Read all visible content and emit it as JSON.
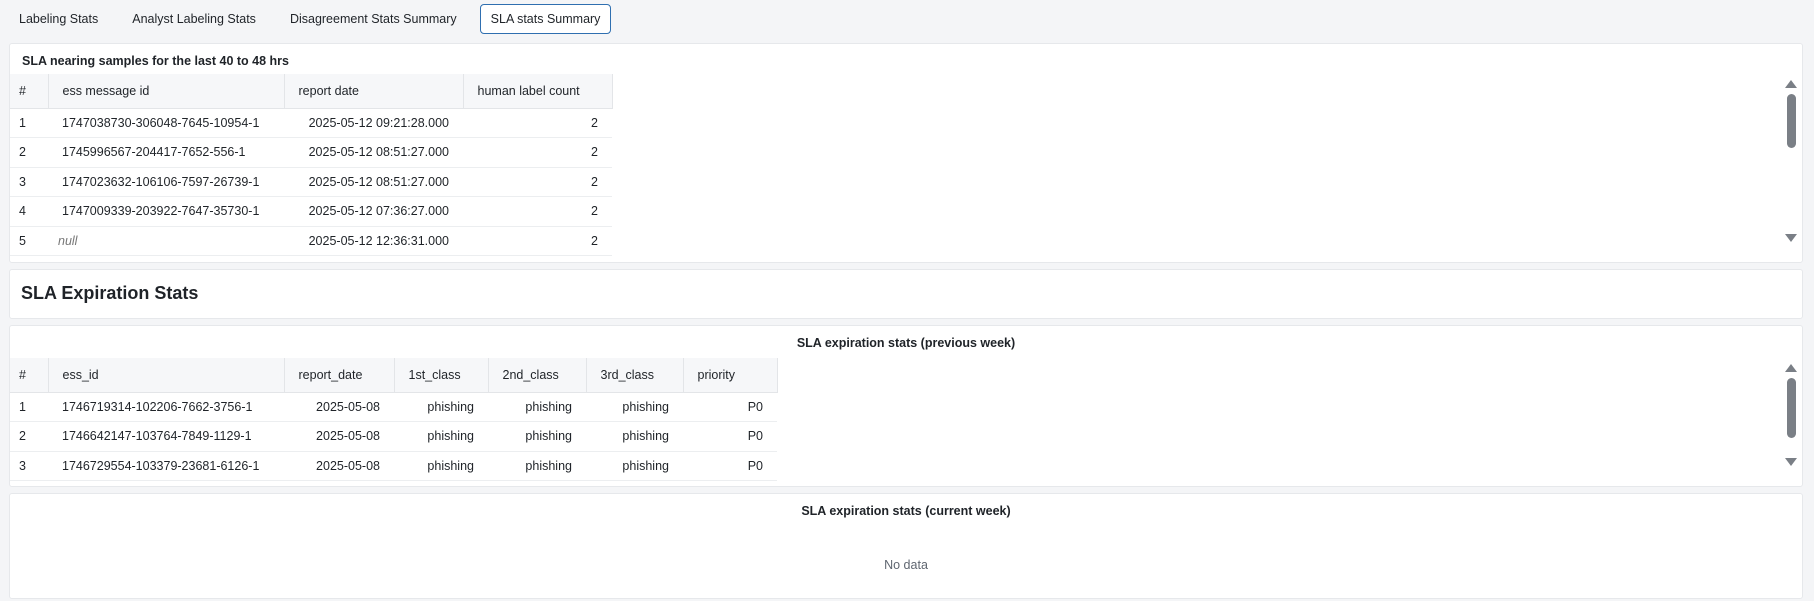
{
  "tabs": [
    {
      "label": "Labeling Stats",
      "active": false
    },
    {
      "label": "Analyst Labeling Stats",
      "active": false
    },
    {
      "label": "Disagreement Stats Summary",
      "active": false
    },
    {
      "label": "SLA stats Summary",
      "active": true
    }
  ],
  "nearing": {
    "title": "SLA nearing samples for the last 40 to 48 hrs",
    "columns": [
      "#",
      "ess message id",
      "report date",
      "human label count"
    ],
    "rows": [
      {
        "idx": "1",
        "id": "1747038730-306048-7645-10954-1",
        "date": "2025-05-12 09:21:28.000",
        "count": "2"
      },
      {
        "idx": "2",
        "id": "1745996567-204417-7652-556-1",
        "date": "2025-05-12 08:51:27.000",
        "count": "2"
      },
      {
        "idx": "3",
        "id": "1747023632-106106-7597-26739-1",
        "date": "2025-05-12 08:51:27.000",
        "count": "2"
      },
      {
        "idx": "4",
        "id": "1747009339-203922-7647-35730-1",
        "date": "2025-05-12 07:36:27.000",
        "count": "2"
      },
      {
        "idx": "5",
        "id": "null",
        "date": "2025-05-12 12:36:31.000",
        "count": "2"
      }
    ]
  },
  "expiration_heading": "SLA Expiration Stats",
  "prev_week": {
    "title": "SLA expiration stats (previous week)",
    "columns": [
      "#",
      "ess_id",
      "report_date",
      "1st_class",
      "2nd_class",
      "3rd_class",
      "priority"
    ],
    "rows": [
      {
        "idx": "1",
        "id": "1746719314-102206-7662-3756-1",
        "date": "2025-05-08",
        "c1": "phishing",
        "c2": "phishing",
        "c3": "phishing",
        "priority": "P0"
      },
      {
        "idx": "2",
        "id": "1746642147-103764-7849-1129-1",
        "date": "2025-05-08",
        "c1": "phishing",
        "c2": "phishing",
        "c3": "phishing",
        "priority": "P0"
      },
      {
        "idx": "3",
        "id": "1746729554-103379-23681-6126-1",
        "date": "2025-05-08",
        "c1": "phishing",
        "c2": "phishing",
        "c3": "phishing",
        "priority": "P0"
      }
    ]
  },
  "curr_week": {
    "title": "SLA expiration stats (current week)",
    "empty_text": "No data"
  },
  "icons": {
    "scroll_up": "triangle-up-icon",
    "scroll_down": "triangle-down-icon"
  },
  "colors": {
    "active_tab_border": "#2f6fb0",
    "scrollbar": "#7a7f86"
  }
}
